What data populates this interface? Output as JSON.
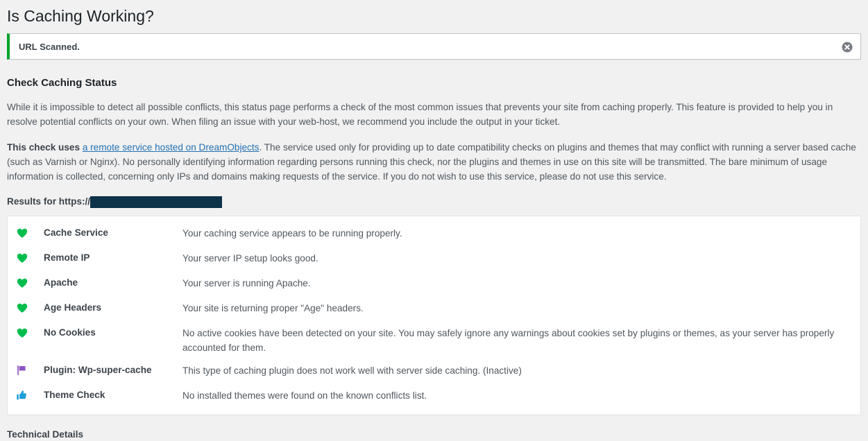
{
  "page": {
    "title": "Is Caching Working?",
    "section_heading": "Check Caching Status",
    "tech_heading": "Technical Details"
  },
  "notice": {
    "text": "URL Scanned.",
    "dismiss_icon": "dismiss-circle-icon",
    "accent_color": "#00a32a"
  },
  "intro": {
    "paragraph1": "While it is impossible to detect all possible conflicts, this status page performs a check of the most common issues that prevents your site from caching properly. This feature is provided to help you in resolve potential conflicts on your own. When filing an issue with your web-host, we recommend you include the output in your ticket.",
    "paragraph2_lead": "This check uses ",
    "paragraph2_link": "a remote service hosted on DreamObjects",
    "paragraph2_rest": ". The service used only for providing up to date compatibility checks on plugins and themes that may conflict with running a server based cache (such as Varnish or Nginx). No personally identifying information regarding persons running this check, nor the plugins and themes in use on this site will be transmitted. The bare minimum of usage information is collected, concerning only IPs and domains making requests of the service. If you do not wish to use this service, please do not use this service.",
    "link_color": "#2271b1"
  },
  "results": {
    "label": "Results for https://",
    "redacted_url": "",
    "redaction_color": "#0d3349",
    "rows": [
      {
        "icon": "heart-icon",
        "icon_color": "#00bd4d",
        "label": "Cache Service",
        "message": "Your caching service appears to be running properly."
      },
      {
        "icon": "heart-icon",
        "icon_color": "#00bd4d",
        "label": "Remote IP",
        "message": "Your server IP setup looks good."
      },
      {
        "icon": "heart-icon",
        "icon_color": "#00bd4d",
        "label": "Apache",
        "message": "Your server is running Apache."
      },
      {
        "icon": "heart-icon",
        "icon_color": "#00bd4d",
        "label": "Age Headers",
        "message": "Your site is returning proper \"Age\" headers."
      },
      {
        "icon": "heart-icon",
        "icon_color": "#00bd4d",
        "label": "No Cookies",
        "message": "No active cookies have been detected on your site. You may safely ignore any warnings about cookies set by plugins or themes, as your server has properly accounted for them."
      },
      {
        "icon": "flag-icon",
        "icon_color": "#8c54c4",
        "label": "Plugin: Wp-super-cache",
        "message": "This type of caching plugin does not work well with server side caching. (Inactive)"
      },
      {
        "icon": "thumbs-up-icon",
        "icon_color": "#1c9ed8",
        "label": "Theme Check",
        "message": "No installed themes were found on the known conflicts list."
      }
    ]
  }
}
